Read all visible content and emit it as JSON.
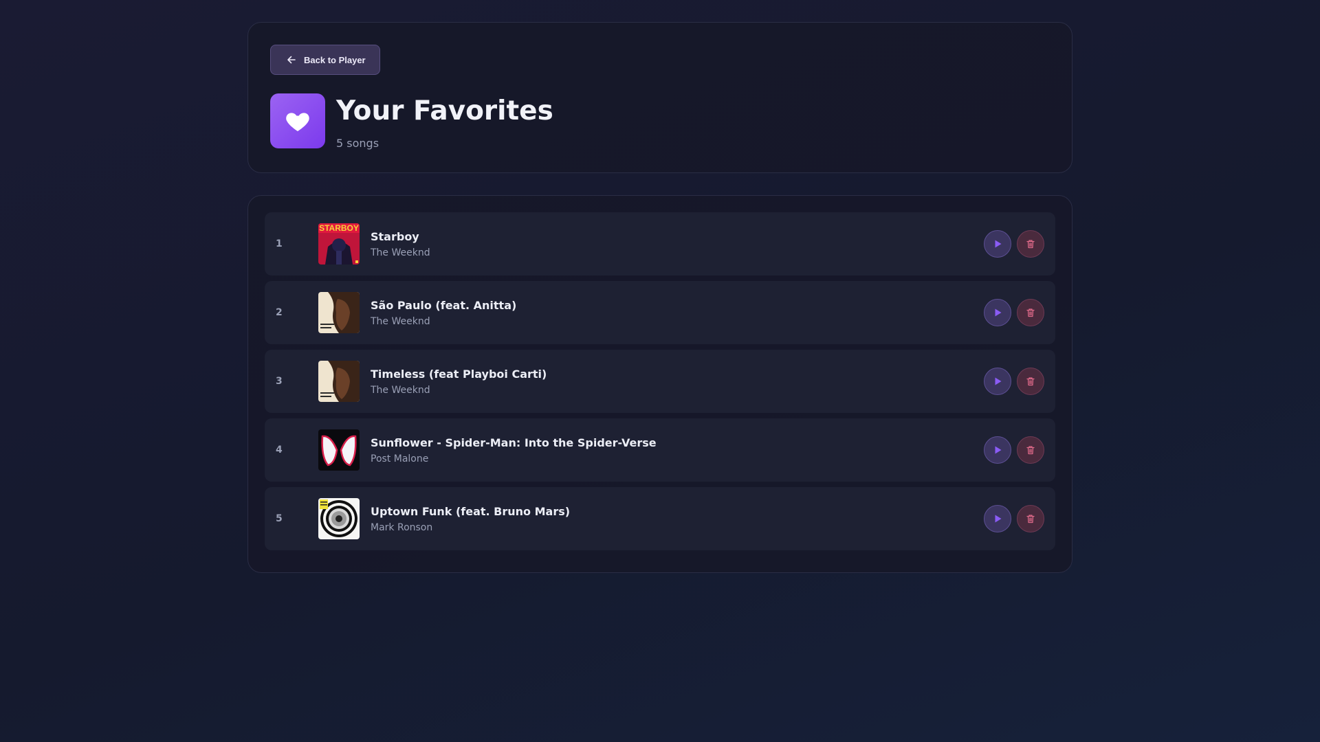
{
  "header": {
    "back_label": "Back to Player",
    "title": "Your Favorites",
    "song_count": "5 songs"
  },
  "colors": {
    "accent": "#8b5cf6",
    "delete": "#e06a8a"
  },
  "tracks": [
    {
      "number": "1",
      "title": "Starboy",
      "artist": "The Weeknd",
      "cover": "starboy-cover",
      "cover_text": "STARBOY"
    },
    {
      "number": "2",
      "title": "São Paulo (feat. Anitta)",
      "artist": "The Weeknd",
      "cover": "hurry-up-tomorrow-cover"
    },
    {
      "number": "3",
      "title": "Timeless (feat Playboi Carti)",
      "artist": "The Weeknd",
      "cover": "hurry-up-tomorrow-cover"
    },
    {
      "number": "4",
      "title": "Sunflower - Spider-Man: Into the Spider-Verse",
      "artist": "Post Malone",
      "cover": "spider-verse-cover"
    },
    {
      "number": "5",
      "title": "Uptown Funk (feat. Bruno Mars)",
      "artist": "Mark Ronson",
      "cover": "uptown-special-cover"
    }
  ]
}
